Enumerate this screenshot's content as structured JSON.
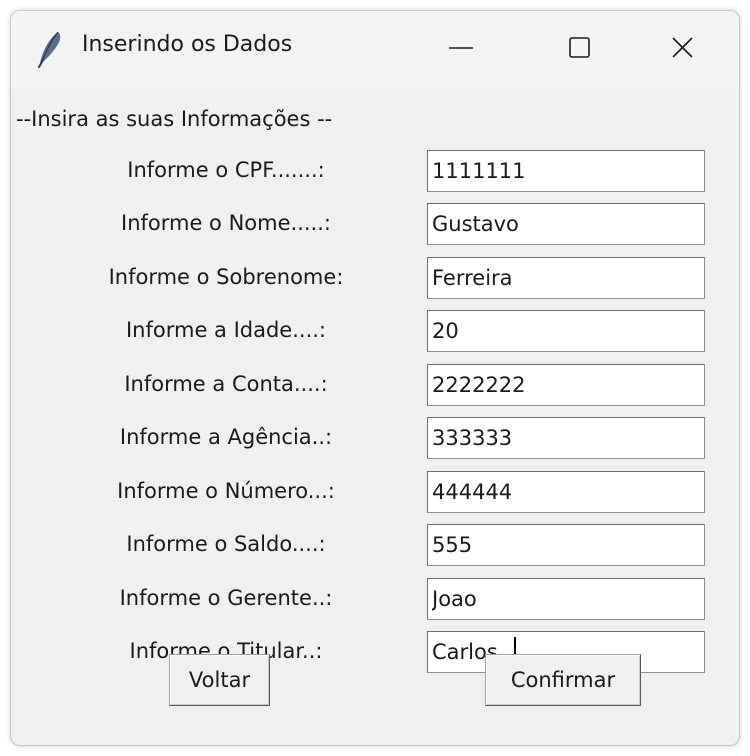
{
  "window": {
    "title": "Inserindo os Dados",
    "icon": "feather-icon",
    "controls": [
      "minimize-icon",
      "maximize-icon",
      "close-icon"
    ]
  },
  "header": "--Insira as suas Informações --",
  "fields": [
    {
      "label": "Informe o CPF.......:",
      "value": "1111111"
    },
    {
      "label": "Informe o Nome.....:",
      "value": "Gustavo"
    },
    {
      "label": "Informe o Sobrenome:",
      "value": "Ferreira"
    },
    {
      "label": "Informe a Idade....:",
      "value": "20"
    },
    {
      "label": "Informe a Conta....:",
      "value": "2222222"
    },
    {
      "label": "Informe a Agência..:",
      "value": "333333"
    },
    {
      "label": "Informe o Número...:",
      "value": "444444"
    },
    {
      "label": "Informe o Saldo....:",
      "value": "555"
    },
    {
      "label": "Informe o Gerente..:",
      "value": "Joao"
    },
    {
      "label": "Informe o Titular..:",
      "value": "Carlos"
    }
  ],
  "buttons": {
    "back": "Voltar",
    "confirm": "Confirmar"
  },
  "colors": {
    "window_bg": "#f0f0f0",
    "titlebar_bg": "#f3f3f3",
    "input_bg": "#ffffff",
    "text": "#1a1a1a"
  }
}
